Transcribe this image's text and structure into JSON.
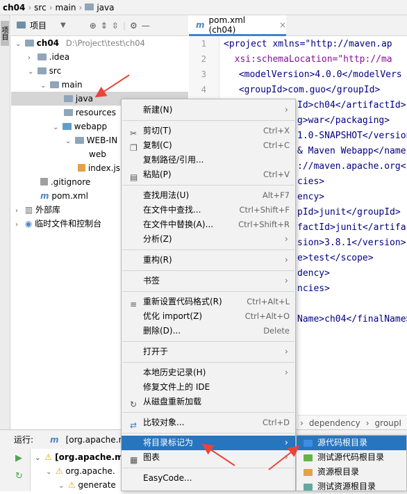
{
  "nav": {
    "project": "ch04",
    "p1": "src",
    "p2": "main",
    "p3": "java"
  },
  "side": {
    "tab": "项目"
  },
  "projectPanel": {
    "title": "项目",
    "tree": [
      {
        "label": "ch04",
        "extra": "D:\\Project\\test\\ch04",
        "icon": "module-folder-icon"
      },
      {
        "label": ".idea",
        "icon": "folder-icon"
      },
      {
        "label": "src",
        "icon": "folder-icon"
      },
      {
        "label": "main",
        "icon": "folder-icon"
      },
      {
        "label": "java",
        "icon": "folder-icon"
      },
      {
        "label": "resources",
        "icon": "folder-icon"
      },
      {
        "label": "webapp",
        "icon": "web-folder-icon"
      },
      {
        "label": "WEB-IN",
        "icon": "folder-icon"
      },
      {
        "label": "web",
        "icon": "xml-file-icon"
      },
      {
        "label": "index.js",
        "icon": "jsp-file-icon"
      },
      {
        "label": ".gitignore",
        "icon": "gitignore-icon"
      },
      {
        "label": "pom.xml",
        "icon": "maven-icon"
      },
      {
        "label": "外部库",
        "icon": "library-icon"
      },
      {
        "label": "临时文件和控制台",
        "icon": "scratch-icon"
      }
    ]
  },
  "editor": {
    "tab": "pom.xml (ch04)",
    "lineNumbers": [
      "1",
      "2",
      "3",
      "4"
    ],
    "lines": [
      "<project xmlns=\"http://maven.ap",
      "  xsi:schemaLocation=\"http://ma",
      " <modelVersion>4.0.0</modelVers",
      " <groupId>com.guo</groupId>",
      "Id>ch04</artifactId>",
      "g>war</packaging>",
      "1.0-SNAPSHOT</version",
      "& Maven Webapp</name",
      "://maven.apache.org<",
      "cies>",
      "ency>",
      "pId>junit</groupId>",
      "factId>junit</artifa",
      "sion>3.8.1</version>",
      "e>test</scope>",
      "dency>",
      "ncies>",
      "Name>ch04</finalName>"
    ]
  },
  "breadcrumb": {
    "a": "dependency",
    "b": "groupI"
  },
  "runPanel": {
    "label": "运行:",
    "config": "[org.apache.m",
    "items": [
      "[org.apache.m",
      "org.apache.",
      "generate"
    ]
  },
  "contextMenu": {
    "items": [
      {
        "label": "新建(N)",
        "shortcut": ""
      },
      {
        "label": "剪切(T)",
        "shortcut": "Ctrl+X"
      },
      {
        "label": "复制(C)",
        "shortcut": "Ctrl+C"
      },
      {
        "label": "复制路径/引用...",
        "shortcut": ""
      },
      {
        "label": "粘贴(P)",
        "shortcut": "Ctrl+V"
      },
      {
        "label": "查找用法(U)",
        "shortcut": "Alt+F7"
      },
      {
        "label": "在文件中查找...",
        "shortcut": "Ctrl+Shift+F"
      },
      {
        "label": "在文件中替换(A)...",
        "shortcut": "Ctrl+Shift+R"
      },
      {
        "label": "分析(Z)",
        "shortcut": ""
      },
      {
        "label": "重构(R)",
        "shortcut": ""
      },
      {
        "label": "书签",
        "shortcut": ""
      },
      {
        "label": "重新设置代码格式(R)",
        "shortcut": "Ctrl+Alt+L"
      },
      {
        "label": "优化 import(Z)",
        "shortcut": "Ctrl+Alt+O"
      },
      {
        "label": "删除(D)...",
        "shortcut": "Delete"
      },
      {
        "label": "打开于",
        "shortcut": ""
      },
      {
        "label": "本地历史记录(H)",
        "shortcut": ""
      },
      {
        "label": "修复文件上的 IDE",
        "shortcut": ""
      },
      {
        "label": "从磁盘重新加载",
        "shortcut": ""
      },
      {
        "label": "比较对象...",
        "shortcut": "Ctrl+D"
      },
      {
        "label": "将目录标记为",
        "shortcut": ""
      },
      {
        "label": "图表",
        "shortcut": ""
      },
      {
        "label": "EasyCode...",
        "shortcut": ""
      }
    ]
  },
  "submenu": {
    "items": [
      "源代码根目录",
      "测试源代码根目录",
      "资源根目录",
      "测试资源根目录"
    ]
  },
  "colors": {
    "selection": "#2675bf",
    "annotationArrow": "#e8443a"
  }
}
